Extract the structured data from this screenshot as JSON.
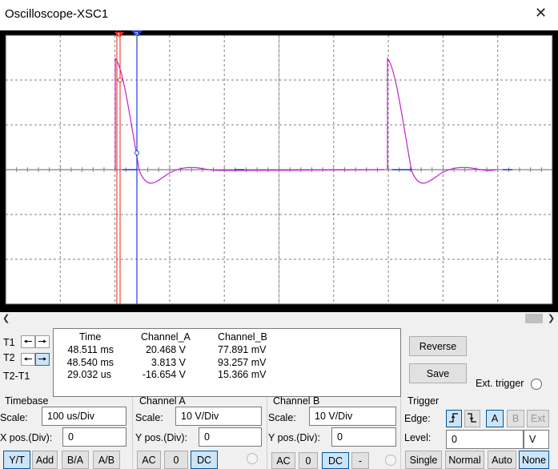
{
  "window": {
    "title": "Oscilloscope-XSC1",
    "close_glyph": "✕"
  },
  "cursors": {
    "t1_label": "T1",
    "t2_label": "T2",
    "diff_label": "T2-T1",
    "t1_marker": "1",
    "t2_marker": "2",
    "t1_color": "#e8241c",
    "t2_color": "#1f3fe0"
  },
  "readout": {
    "headers": [
      "Time",
      "Channel_A",
      "Channel_B"
    ],
    "rows": [
      [
        "48.511 ms",
        "20.468 V",
        "77.891 mV"
      ],
      [
        "48.540 ms",
        "3.813 V",
        "93.257 mV"
      ],
      [
        "29.032 us",
        "-16.654 V",
        "15.366 mV"
      ]
    ]
  },
  "buttons": {
    "reverse": "Reverse",
    "save": "Save",
    "ext_trigger": "Ext. trigger"
  },
  "timebase": {
    "group": "Timebase",
    "scale_label": "Scale:",
    "scale_value": "100 us/Div",
    "xpos_label": "X pos.(Div):",
    "xpos_value": "0",
    "modes": [
      "Y/T",
      "Add",
      "B/A",
      "A/B"
    ],
    "active_mode": "Y/T"
  },
  "channel_a": {
    "group": "Channel A",
    "scale_label": "Scale:",
    "scale_value": "10  V/Div",
    "ypos_label": "Y pos.(Div):",
    "ypos_value": "0",
    "coupling": [
      "AC",
      "0",
      "DC"
    ],
    "active_coupling": "DC"
  },
  "channel_b": {
    "group": "Channel B",
    "scale_label": "Scale:",
    "scale_value": "10  V/Div",
    "ypos_label": "Y pos.(Div):",
    "ypos_value": "0",
    "coupling": [
      "AC",
      "0",
      "DC",
      "-"
    ],
    "active_coupling": "DC"
  },
  "trigger": {
    "group": "Trigger",
    "edge_label": "Edge:",
    "level_label": "Level:",
    "level_value": "0",
    "level_unit": "V",
    "sources": [
      "A",
      "B",
      "Ext"
    ],
    "active_source": "A",
    "modes": [
      "Single",
      "Normal",
      "Auto",
      "None"
    ],
    "active_mode": "None"
  },
  "colors": {
    "trace_a": "#c020d0",
    "trace_b": "#1f3fe0",
    "grid": "#808080",
    "screen_bg": "#ffffff"
  },
  "icons": {
    "rising_edge": "rising-edge-icon",
    "falling_edge": "falling-edge-icon"
  }
}
